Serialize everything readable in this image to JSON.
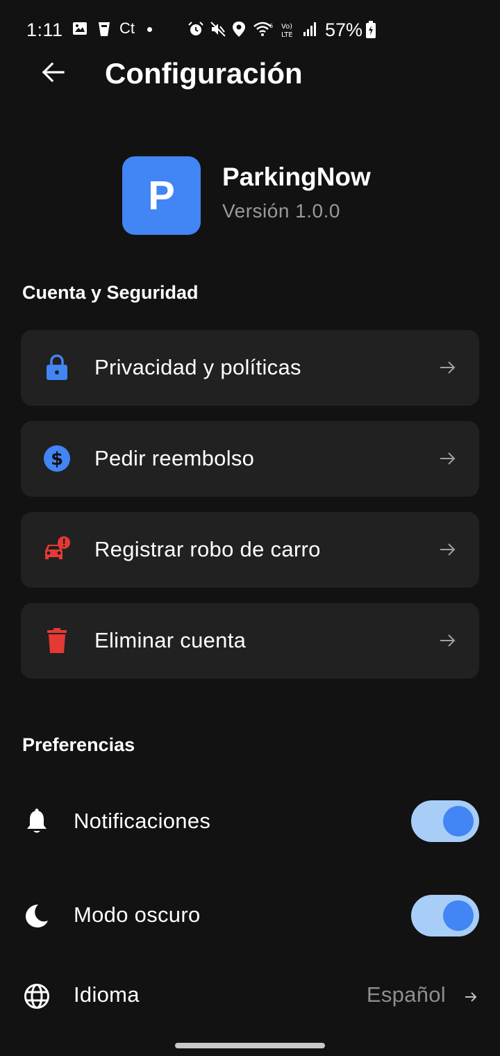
{
  "status_bar": {
    "time": "1:11",
    "carrier_icon_text": "Ct",
    "battery_percent": "57%",
    "icons": [
      "gallery-icon",
      "cup-icon",
      "alarm-icon",
      "mute-icon",
      "location-icon",
      "wifi-icon",
      "volte-icon",
      "signal-icon",
      "battery-charging-icon"
    ]
  },
  "header": {
    "title": "Configuración",
    "back_icon": "arrow-left-icon"
  },
  "app_info": {
    "logo_letter": "P",
    "name": "ParkingNow",
    "version": "Versión 1.0.0",
    "logo_color": "#4285F4"
  },
  "account_section": {
    "title": "Cuenta y Seguridad",
    "items": [
      {
        "label": "Privacidad y políticas",
        "icon": "lock-icon",
        "icon_color": "#4285F4"
      },
      {
        "label": "Pedir reembolso",
        "icon": "dollar-circle-icon",
        "icon_color": "#4285F4"
      },
      {
        "label": "Registrar robo de carro",
        "icon": "car-alert-icon",
        "icon_color": "#E53935"
      },
      {
        "label": "Eliminar cuenta",
        "icon": "trash-icon",
        "icon_color": "#E53935"
      }
    ]
  },
  "preferences_section": {
    "title": "Preferencias",
    "notifications": {
      "label": "Notificaciones",
      "icon": "bell-icon",
      "enabled": true
    },
    "dark_mode": {
      "label": "Modo oscuro",
      "icon": "moon-icon",
      "enabled": true
    },
    "language": {
      "label": "Idioma",
      "icon": "globe-icon",
      "value": "Español"
    }
  },
  "colors": {
    "background": "#121212",
    "card": "#212121",
    "accent": "#4285F4",
    "toggle_track": "#A8CDF7",
    "danger": "#E53935"
  }
}
